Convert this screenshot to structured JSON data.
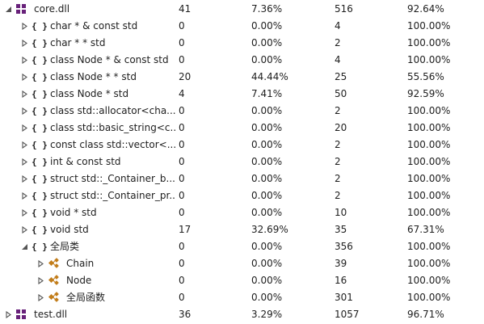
{
  "rows": [
    {
      "level": 0,
      "expanded": true,
      "icon": "dll-icon",
      "name": "core.dll",
      "c1": "41",
      "c2": "7.36%",
      "c3": "516",
      "c4": "92.64%"
    },
    {
      "level": 1,
      "expanded": false,
      "icon": "namespace-icon",
      "name": "char * & const std",
      "c1": "0",
      "c2": "0.00%",
      "c3": "4",
      "c4": "100.00%"
    },
    {
      "level": 1,
      "expanded": false,
      "icon": "namespace-icon",
      "name": "char * * std",
      "c1": "0",
      "c2": "0.00%",
      "c3": "2",
      "c4": "100.00%"
    },
    {
      "level": 1,
      "expanded": false,
      "icon": "namespace-icon",
      "name": "class Node * & const std",
      "c1": "0",
      "c2": "0.00%",
      "c3": "4",
      "c4": "100.00%"
    },
    {
      "level": 1,
      "expanded": false,
      "icon": "namespace-icon",
      "name": "class Node * * std",
      "c1": "20",
      "c2": "44.44%",
      "c3": "25",
      "c4": "55.56%"
    },
    {
      "level": 1,
      "expanded": false,
      "icon": "namespace-icon",
      "name": "class Node * std",
      "c1": "4",
      "c2": "7.41%",
      "c3": "50",
      "c4": "92.59%"
    },
    {
      "level": 1,
      "expanded": false,
      "icon": "namespace-icon",
      "name": "class std::allocator<cha...",
      "c1": "0",
      "c2": "0.00%",
      "c3": "2",
      "c4": "100.00%"
    },
    {
      "level": 1,
      "expanded": false,
      "icon": "namespace-icon",
      "name": "class std::basic_string<c...",
      "c1": "0",
      "c2": "0.00%",
      "c3": "20",
      "c4": "100.00%"
    },
    {
      "level": 1,
      "expanded": false,
      "icon": "namespace-icon",
      "name": "const class std::vector<...",
      "c1": "0",
      "c2": "0.00%",
      "c3": "2",
      "c4": "100.00%"
    },
    {
      "level": 1,
      "expanded": false,
      "icon": "namespace-icon",
      "name": "int & const std",
      "c1": "0",
      "c2": "0.00%",
      "c3": "2",
      "c4": "100.00%"
    },
    {
      "level": 1,
      "expanded": false,
      "icon": "namespace-icon",
      "name": "struct std::_Container_b...",
      "c1": "0",
      "c2": "0.00%",
      "c3": "2",
      "c4": "100.00%"
    },
    {
      "level": 1,
      "expanded": false,
      "icon": "namespace-icon",
      "name": "struct std::_Container_pr...",
      "c1": "0",
      "c2": "0.00%",
      "c3": "2",
      "c4": "100.00%"
    },
    {
      "level": 1,
      "expanded": false,
      "icon": "namespace-icon",
      "name": "void * std",
      "c1": "0",
      "c2": "0.00%",
      "c3": "10",
      "c4": "100.00%"
    },
    {
      "level": 1,
      "expanded": false,
      "icon": "namespace-icon",
      "name": "void std",
      "c1": "17",
      "c2": "32.69%",
      "c3": "35",
      "c4": "67.31%"
    },
    {
      "level": 1,
      "expanded": true,
      "icon": "namespace-icon",
      "name": "全局类",
      "c1": "0",
      "c2": "0.00%",
      "c3": "356",
      "c4": "100.00%"
    },
    {
      "level": 2,
      "expanded": false,
      "icon": "class-icon",
      "name": "Chain",
      "c1": "0",
      "c2": "0.00%",
      "c3": "39",
      "c4": "100.00%"
    },
    {
      "level": 2,
      "expanded": false,
      "icon": "class-icon",
      "name": "Node",
      "c1": "0",
      "c2": "0.00%",
      "c3": "16",
      "c4": "100.00%"
    },
    {
      "level": 2,
      "expanded": false,
      "icon": "class-icon",
      "name": "全局函数",
      "c1": "0",
      "c2": "0.00%",
      "c3": "301",
      "c4": "100.00%"
    },
    {
      "level": 0,
      "expanded": false,
      "icon": "dll-icon",
      "name": "test.dll",
      "c1": "36",
      "c2": "3.29%",
      "c3": "1057",
      "c4": "96.71%"
    }
  ],
  "namespace_glyph": "{ }",
  "colors": {
    "dll": "#68217a",
    "class": "#c27d1a",
    "arrow": "#555555"
  }
}
